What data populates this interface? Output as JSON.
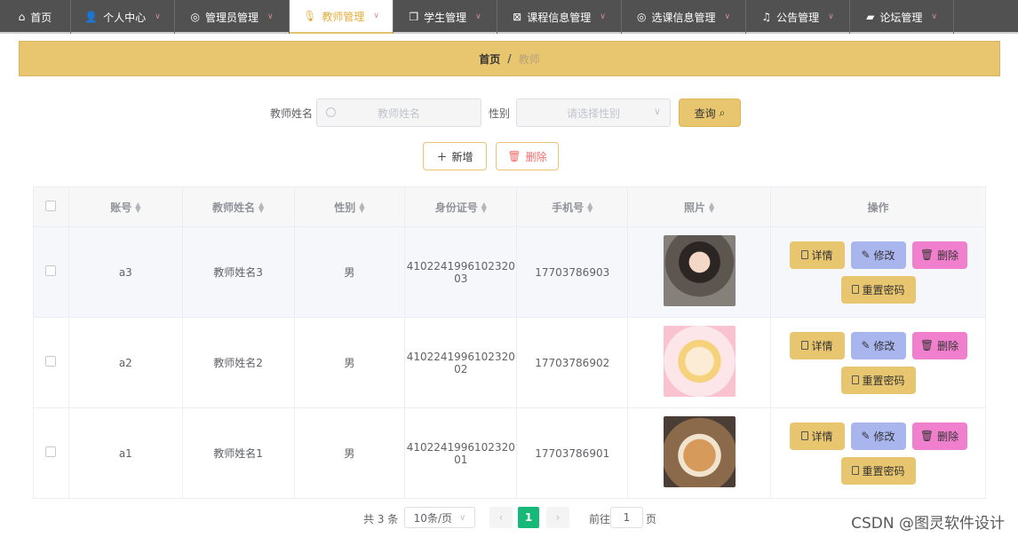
{
  "nav": {
    "items": [
      {
        "label": "首页",
        "icon": "home-icon",
        "width": 80,
        "active": false,
        "chevron": false
      },
      {
        "label": "个人中心",
        "icon": "user-icon",
        "width": 117,
        "active": false,
        "chevron": true
      },
      {
        "label": "管理员管理",
        "icon": "compass-icon",
        "width": 129,
        "active": false,
        "chevron": true
      },
      {
        "label": "教师管理",
        "icon": "microphone-icon",
        "width": 117,
        "active": true,
        "chevron": true
      },
      {
        "label": "学生管理",
        "icon": "copy-icon",
        "width": 117,
        "active": false,
        "chevron": true
      },
      {
        "label": "课程信息管理",
        "icon": "box-icon",
        "width": 140,
        "active": false,
        "chevron": true
      },
      {
        "label": "选课信息管理",
        "icon": "compass-icon",
        "width": 140,
        "active": false,
        "chevron": true
      },
      {
        "label": "公告管理",
        "icon": "bell-icon",
        "width": 117,
        "active": false,
        "chevron": true
      },
      {
        "label": "论坛管理",
        "icon": "forum-icon",
        "width": 117,
        "active": false,
        "chevron": true
      }
    ]
  },
  "breadcrumb": {
    "home": "首页",
    "sep": "/",
    "current": "教师"
  },
  "search": {
    "name_label": "教师姓名",
    "name_placeholder": "教师姓名",
    "gender_label": "性别",
    "gender_placeholder": "请选择性别",
    "query_label": "查询"
  },
  "actions": {
    "add_label": "新增",
    "delete_label": "删除"
  },
  "table": {
    "headers": [
      "账号",
      "教师姓名",
      "性别",
      "身份证号",
      "手机号",
      "照片",
      "操作"
    ],
    "rows": [
      {
        "account": "a3",
        "name": "教师姓名3",
        "gender": "男",
        "id_line1": "4102241996102320",
        "id_line2": "03",
        "phone": "17703786903",
        "photo": "photo-girl"
      },
      {
        "account": "a2",
        "name": "教师姓名2",
        "gender": "男",
        "id_line1": "4102241996102320",
        "id_line2": "02",
        "phone": "17703786902",
        "photo": "photo-anime"
      },
      {
        "account": "a1",
        "name": "教师姓名1",
        "gender": "男",
        "id_line1": "4102241996102320",
        "id_line2": "01",
        "phone": "17703786901",
        "photo": "photo-cat"
      }
    ],
    "ops": {
      "detail": "详情",
      "edit": "修改",
      "delete": "删除",
      "reset": "重置密码"
    }
  },
  "pagination": {
    "total": "共 3 条",
    "page_size": "10条/页",
    "current_page": "1",
    "goto_label": "前往",
    "goto_value": "1",
    "page_suffix": "页"
  },
  "watermark": "CSDN @图灵软件设计",
  "colors": {
    "accent": "#e8c56f",
    "nav_bg": "#515151",
    "page_active": "#17b978",
    "edit": "#a9b6ee",
    "delete": "#f07fcd"
  }
}
